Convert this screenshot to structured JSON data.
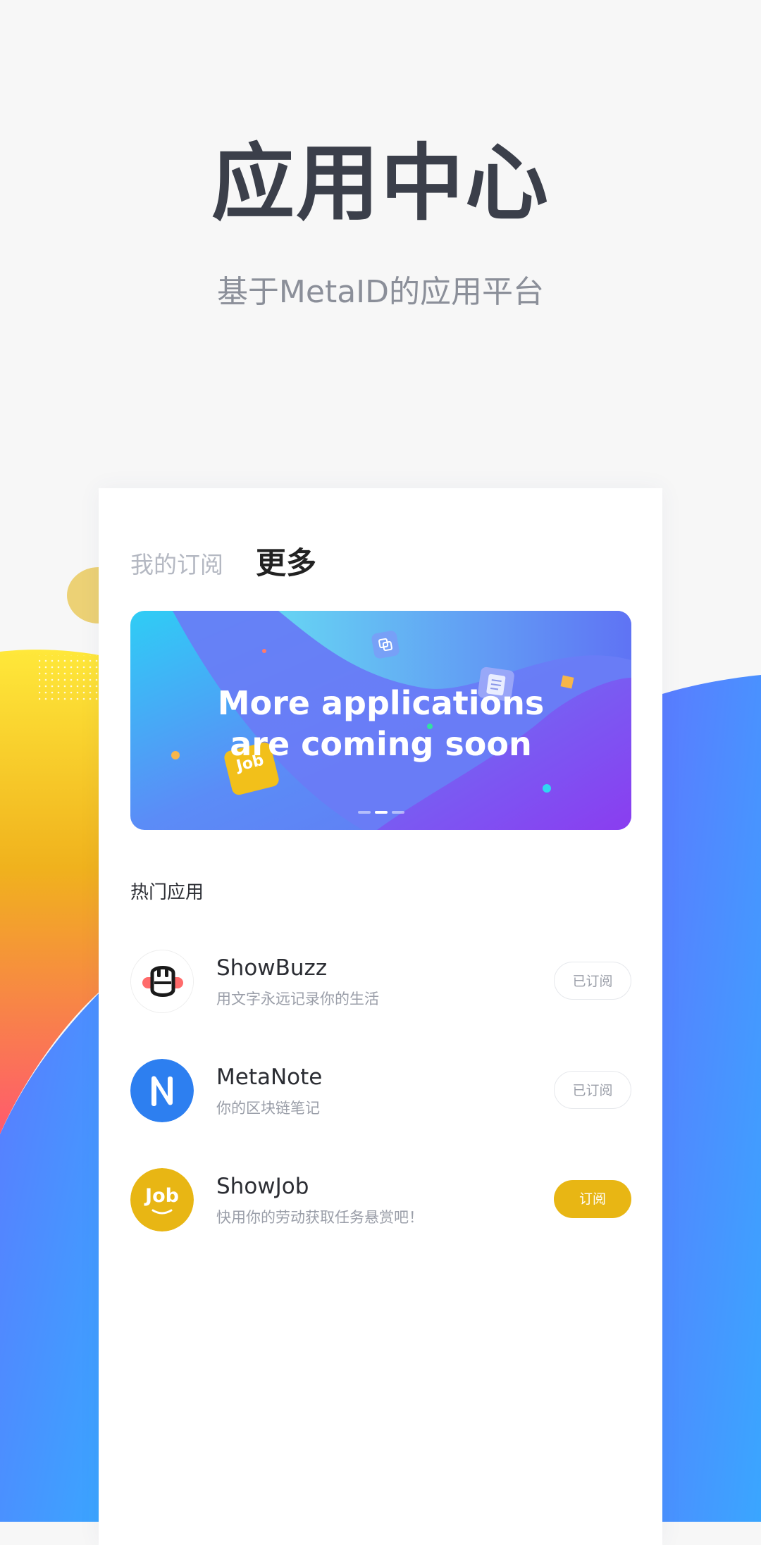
{
  "header": {
    "title": "应用中心",
    "subtitle": "基于MetaID的应用平台"
  },
  "tabs": [
    {
      "label": "我的订阅",
      "active": false
    },
    {
      "label": "更多",
      "active": true
    }
  ],
  "banner": {
    "line1": "More applications",
    "line2": "are coming soon",
    "badge_text": "Job",
    "page_count": 3,
    "active_page": 2
  },
  "section": {
    "title": "热门应用"
  },
  "apps": [
    {
      "name": "ShowBuzz",
      "description": "用文字永远记录你的生活",
      "button": "已订阅",
      "subscribed": true,
      "icon": "showbuzz-icon"
    },
    {
      "name": "MetaNote",
      "description": "你的区块链笔记",
      "button": "已订阅",
      "subscribed": true,
      "icon": "metanote-icon"
    },
    {
      "name": "ShowJob",
      "description": "快用你的劳动获取任务悬赏吧！",
      "button": "订阅",
      "subscribed": false,
      "icon": "showjob-icon"
    }
  ],
  "colors": {
    "accent_yellow": "#e8b614",
    "accent_blue": "#2d7ff0",
    "title_text": "#3b3f4a"
  }
}
